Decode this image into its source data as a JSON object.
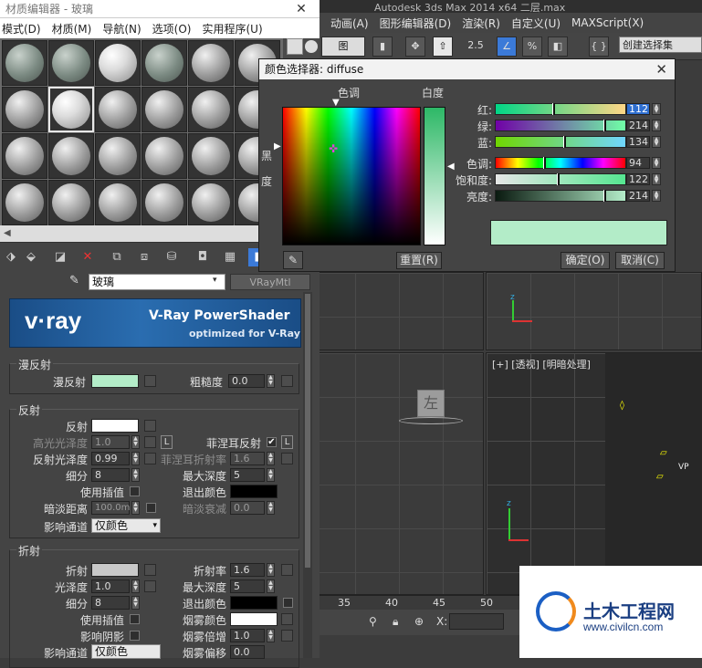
{
  "max_window": {
    "title": "Autodesk 3ds Max  2014 x64    二层.max",
    "menu": [
      "动画(A)",
      "图形编辑器(D)",
      "渲染(R)",
      "自定义(U)",
      "MAXScript(X)"
    ],
    "toolbar": {
      "snap_value": "2.5",
      "selection_set_placeholder": "创建选择集"
    }
  },
  "material_editor": {
    "title": "材质编辑器 - 玻璃",
    "menu": [
      "模式(D)",
      "材质(M)",
      "导航(N)",
      "选项(O)",
      "实用程序(U)"
    ],
    "material_name": "玻璃",
    "material_type": "VRayMtl",
    "banner": {
      "logo": "v·ray",
      "title": "V-Ray PowerShader",
      "subtitle": "optimized for V-Ray"
    },
    "diffuse": {
      "group": "漫反射",
      "diffuse_label": "漫反射",
      "diffuse_color": "#b3ecc8",
      "roughness_label": "粗糙度",
      "roughness_value": "0.0"
    },
    "reflection": {
      "group": "反射",
      "reflect_label": "反射",
      "reflect_color": "#ffffff",
      "hilight_gloss_label": "高光光泽度",
      "hilight_gloss_value": "1.0",
      "l_btn": "L",
      "fresnel_label": "菲涅耳反射",
      "fresnel_checked": "✔",
      "refl_gloss_label": "反射光泽度",
      "refl_gloss_value": "0.99",
      "fresnel_ior_label": "菲涅耳折射率",
      "fresnel_ior_value": "1.6",
      "subdivs_label": "细分",
      "subdivs_value": "8",
      "max_depth_label": "最大深度",
      "max_depth_value": "5",
      "use_interp_label": "使用插值",
      "exit_color_label": "退出颜色",
      "exit_color": "#000000",
      "dim_distance_label": "暗淡距离",
      "dim_distance_value": "100.0m",
      "dim_falloff_label": "暗淡衰减",
      "dim_falloff_value": "0.0",
      "affect_channels_label": "影响通道",
      "affect_channels_value": "仅颜色"
    },
    "refraction": {
      "group": "折射",
      "refract_label": "折射",
      "refract_color": "#c8c8c8",
      "ior_label": "折射率",
      "ior_value": "1.6",
      "gloss_label": "光泽度",
      "gloss_value": "1.0",
      "max_depth_label": "最大深度",
      "max_depth_value": "5",
      "subdivs_label": "细分",
      "subdivs_value": "8",
      "exit_color_label": "退出颜色",
      "exit_color": "#000000",
      "use_interp_label": "使用插值",
      "fog_color_label": "烟雾颜色",
      "fog_color": "#ffffff",
      "affect_shadows_label": "影响阴影",
      "fog_mult_label": "烟雾倍增",
      "fog_mult_value": "1.0",
      "affect_channels_label": "影响通道",
      "affect_channels_value": "仅颜色",
      "fog_bias_label": "烟雾偏移",
      "fog_bias_value": "0.0"
    }
  },
  "color_selector": {
    "title": "颜色选择器: diffuse",
    "hue_label": "色调",
    "whiteness_label": "白度",
    "blackness_label": "黑度",
    "channels": [
      {
        "label": "红:",
        "value": "112",
        "frac": 0.44,
        "grad": "linear-gradient(90deg,#00d686,#ffd686)"
      },
      {
        "label": "绿:",
        "value": "214",
        "frac": 0.84,
        "grad": "linear-gradient(90deg,#7000a6,#70ffa6)"
      },
      {
        "label": "蓝:",
        "value": "134",
        "frac": 0.53,
        "grad": "linear-gradient(90deg,#70d600,#70d6ff)"
      },
      {
        "label": "色调:",
        "value": "94",
        "frac": 0.37,
        "grad": "linear-gradient(90deg,#f00,#ff0 17%,#0f0 33%,#0ff 50%,#00f 67%,#f0f 83%,#f00)"
      },
      {
        "label": "饱和度:",
        "value": "122",
        "frac": 0.48,
        "grad": "linear-gradient(90deg,#e6e6e6,#55e690)"
      },
      {
        "label": "亮度:",
        "value": "214",
        "frac": 0.84,
        "grad": "linear-gradient(90deg,#0a1a10,#b3ecc8)"
      }
    ],
    "preview_color": "#b3ecc8",
    "reset": "重置(R)",
    "ok": "确定(O)",
    "cancel": "取消(C)"
  },
  "viewports": {
    "left_label": "左",
    "persp_label": "[+] [透视] [明暗处理]",
    "timeline_ticks": [
      "35",
      "40",
      "45",
      "50"
    ],
    "status_x_label": "X:"
  },
  "watermark": {
    "name": "土木工程网",
    "url": "www.civilcn.com"
  }
}
